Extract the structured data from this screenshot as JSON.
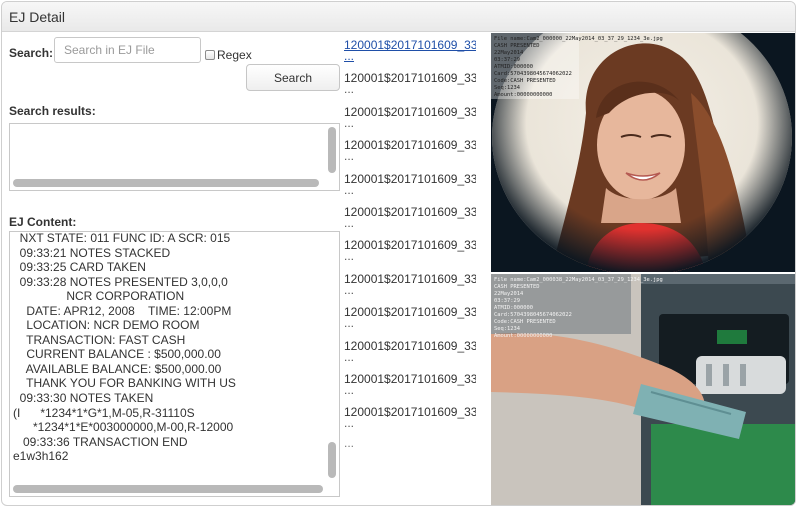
{
  "panel": {
    "title": "EJ Detail"
  },
  "search": {
    "label": "Search:",
    "placeholder": "Search in EJ File",
    "value": "",
    "regex_label": "Regex",
    "regex_checked": false,
    "button_label": "Search"
  },
  "results": {
    "label": "Search results:"
  },
  "ej_content": {
    "label": "EJ Content:",
    "lines": [
      "  NXT STATE: 011 FUNC ID: A SCR: 015",
      "  09:33:21 NOTES STACKED",
      "  09:33:25 CARD TAKEN",
      "  09:33:28 NOTES PRESENTED 3,0,0,0",
      "                NCR CORPORATION",
      "    DATE: APR12, 2008    TIME: 12:00PM",
      "    LOCATION: NCR DEMO ROOM",
      "    TRANSACTION: FAST CASH",
      "    CURRENT BALANCE : $500,000.00",
      "    AVAILABLE BALANCE: $500,000.00",
      "    THANK YOU FOR BANKING WITH US",
      "  09:33:30 NOTES TAKEN",
      "(I      *1234*1*G*1,M-05,R-31110S",
      "      *1234*1*E*003000000,M-00,R-12000",
      "   09:33:36 TRANSACTION END",
      "e1w3h162"
    ]
  },
  "files": {
    "items": [
      {
        "name": "120001$2017101609_33",
        "more": "...",
        "active": true
      },
      {
        "name": "120001$2017101609_33",
        "more": "...",
        "active": false
      },
      {
        "name": "120001$2017101609_33",
        "more": "...",
        "active": false
      },
      {
        "name": "120001$2017101609_33",
        "more": "...",
        "active": false
      },
      {
        "name": "120001$2017101609_33",
        "more": "...",
        "active": false
      },
      {
        "name": "120001$2017101609_33",
        "more": "...",
        "active": false
      },
      {
        "name": "120001$2017101609_33",
        "more": "...",
        "active": false
      },
      {
        "name": "120001$2017101609_33",
        "more": "...",
        "active": false
      },
      {
        "name": "120001$2017101609_33",
        "more": "...",
        "active": false
      },
      {
        "name": "120001$2017101609_33",
        "more": "...",
        "active": false
      },
      {
        "name": "120001$2017101609_33",
        "more": "...",
        "active": false
      },
      {
        "name": "120001$2017101609_33",
        "more": "...",
        "active": false
      }
    ],
    "tail": "..."
  },
  "cameras": [
    {
      "overlay_lines": [
        "File name:Cam2_000000_22May2014_03_37_29_1234_3e.jpg",
        "CASH PRESENTED",
        "22May2014",
        "03:37:29",
        "ATMID:000000",
        "Card:5704398045674062022",
        "Code:CASH PRESENTED",
        "Seq:1234",
        "Amount:00000000000"
      ]
    },
    {
      "overlay_lines": [
        "File name:Cam2_000038_22May2014_03_37_29_1234_3e.jpg",
        "CASH PRESENTED",
        "22May2014",
        "03:37:29",
        "ATMID:000000",
        "Card:5704398045674062022",
        "Code:CASH PRESENTED",
        "Seq:1234",
        "Amount:00000000000"
      ]
    }
  ],
  "colors": {
    "link": "#1f4fa8",
    "header_bg": "#ececec",
    "border": "#cfcfcf"
  }
}
